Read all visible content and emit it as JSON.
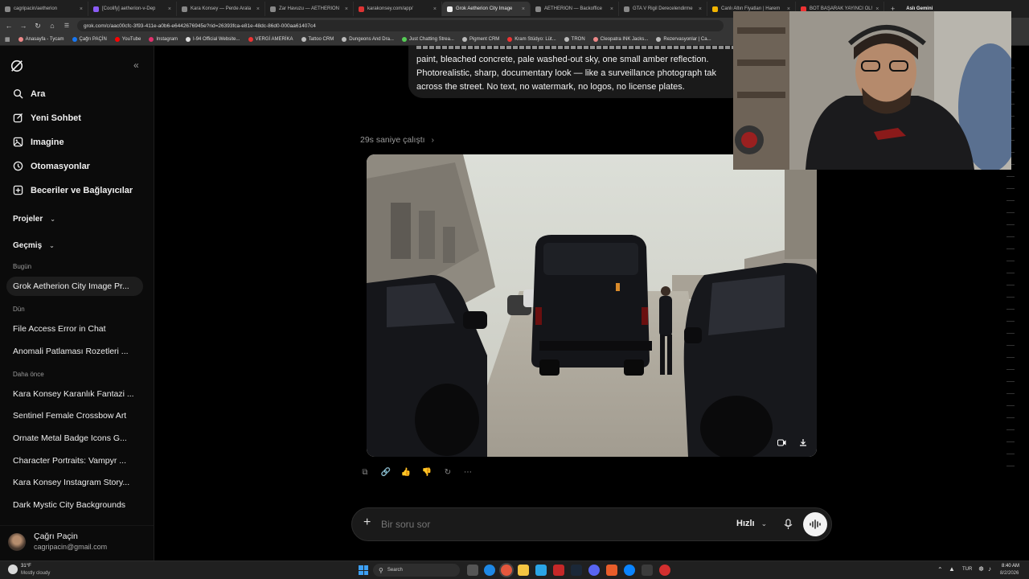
{
  "browser": {
    "tabs": [
      {
        "label": "cagripacin/aetherion",
        "color": "#888888"
      },
      {
        "label": "[Coolify] aetherion-v-Dep",
        "color": "#8b5cf6"
      },
      {
        "label": "Kara Konsey — Perde Arala",
        "color": "#888888"
      },
      {
        "label": "Zar Havuzu — AETHERION",
        "color": "#888888"
      },
      {
        "label": "karakonsey.com/app/",
        "color": "#d33"
      },
      {
        "label": "Grok Aetherion City Image",
        "color": "#eeeeee",
        "active": true
      },
      {
        "label": "AETHERION — Backoffice",
        "color": "#888888"
      },
      {
        "label": "GTA V Rigil Derecelendirme",
        "color": "#888888"
      },
      {
        "label": "Canlı Altın Fiyatları | Harem",
        "color": "#f2b400"
      },
      {
        "label": "BOT BAŞARAK YAYINCI OL!",
        "color": "#e33"
      }
    ],
    "profile_label": "Aslı Gemini",
    "url": "grok.com/c/aac00cfc-3f93-411e-a0b6-e6442676945e?rid=26393fca-e81e-48dc-86d0-000aa61407c4",
    "bookmarks": [
      {
        "label": "Anasayfa - Tycam",
        "color": "#e88"
      },
      {
        "label": "Çağrı PAÇİN",
        "color": "#1877f2"
      },
      {
        "label": "YouTube",
        "color": "#f00"
      },
      {
        "label": "Instagram",
        "color": "#e1306c"
      },
      {
        "label": "I-94 Official Website...",
        "color": "#ddd"
      },
      {
        "label": "VERGİ AMERİKA",
        "color": "#e33"
      },
      {
        "label": "Tattoo CRM",
        "color": "#bbb"
      },
      {
        "label": "Dungeons And Dra...",
        "color": "#bbb"
      },
      {
        "label": "Just Chatting Strea...",
        "color": "#5c5"
      },
      {
        "label": "Pigment CRM",
        "color": "#bbb"
      },
      {
        "label": "Kram Stüdyo: Lüt...",
        "color": "#e33"
      },
      {
        "label": "TRON",
        "color": "#bbb"
      },
      {
        "label": "Cleopatra INK Jacks...",
        "color": "#e88"
      },
      {
        "label": "Rezervasyonlar | Ca...",
        "color": "#bbb"
      }
    ]
  },
  "sidebar": {
    "nav": [
      {
        "label": "Ara",
        "icon": "search-icon"
      },
      {
        "label": "Yeni Sohbet",
        "icon": "edit-icon"
      },
      {
        "label": "Imagine",
        "icon": "image-icon"
      },
      {
        "label": "Otomasyonlar",
        "icon": "clock-icon"
      },
      {
        "label": "Beceriler ve Bağlayıcılar",
        "icon": "plugin-icon"
      }
    ],
    "projects_label": "Projeler",
    "history_label": "Geçmiş",
    "today_label": "Bugün",
    "today_items": [
      "Grok Aetherion City Image Pr..."
    ],
    "yesterday_label": "Dün",
    "yesterday_items": [
      "File Access Error in Chat",
      "Anomali Patlaması Rozetleri ..."
    ],
    "earlier_label": "Daha önce",
    "earlier_items": [
      "Kara Konsey Karanlık Fantazi ...",
      "Sentinel Female Crossbow Art",
      "Ornate Metal Badge Icons G...",
      "Character Portraits: Vampyr ...",
      "Kara Konsey Instagram Story...",
      "Dark Mystic City Backgrounds"
    ],
    "user": {
      "name": "Çağrı Paçin",
      "email": "cagripacin@gmail.com"
    }
  },
  "chat": {
    "prompt_lines": [
      "paint, bleached concrete, pale washed-out sky, one small amber reflection.",
      "Photorealistic, sharp, documentary look — like a surveillance photograph tak",
      "across the street. No text, no watermark, no logos, no license plates."
    ],
    "thought_label": "29s saniye çalıştı",
    "composer_placeholder": "Bir soru sor",
    "mode_label": "Hızlı"
  },
  "taskbar": {
    "weather_temp": "31°F",
    "weather_desc": "Mostly cloudy",
    "search_label": "Search",
    "lang": "TUR",
    "time": "8:40 AM",
    "date": "8/2/2026"
  }
}
